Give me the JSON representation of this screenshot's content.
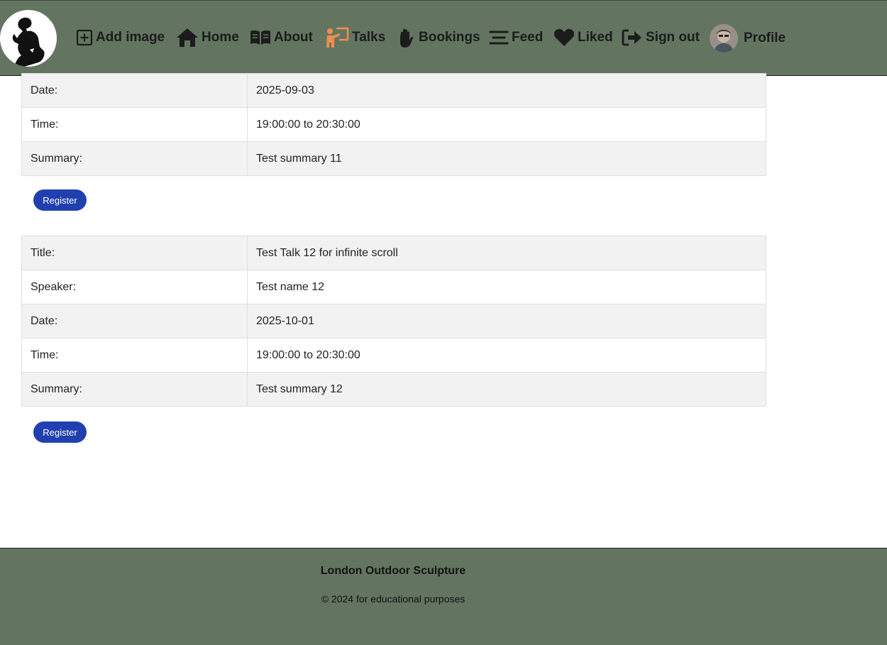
{
  "navbar": {
    "logo_icon": "thinker-silhouette-logo",
    "items": [
      {
        "label": "Add image",
        "icon": "plus-square-icon",
        "color": "#1c1c1c"
      },
      {
        "label": "Home",
        "icon": "home-icon",
        "color": "#1c1c1c"
      },
      {
        "label": "About",
        "icon": "book-open-icon",
        "color": "#1c1c1c"
      },
      {
        "label": "Talks",
        "icon": "lecturer-icon",
        "color": "#1c1c1c",
        "icon_color": "#f0904a"
      },
      {
        "label": "Bookings",
        "icon": "hand-icon",
        "color": "#1c1c1c"
      },
      {
        "label": "Feed",
        "icon": "stream-icon",
        "color": "#1c1c1c"
      },
      {
        "label": "Liked",
        "icon": "heart-icon",
        "color": "#1c1c1c"
      },
      {
        "label": "Sign out",
        "icon": "sign-out-icon",
        "color": "#1c1c1c"
      },
      {
        "label": "Profile",
        "icon": "avatar",
        "color": "#1c1c1c"
      }
    ]
  },
  "talks": [
    {
      "rows": [
        {
          "label": "Date:",
          "value": "2025-09-03"
        },
        {
          "label": "Time:",
          "value": "19:00:00 to 20:30:00"
        },
        {
          "label": "Summary:",
          "value": "Test summary 11"
        }
      ],
      "button": "Register"
    },
    {
      "rows": [
        {
          "label": "Title:",
          "value": "Test Talk 12 for infinite scroll"
        },
        {
          "label": "Speaker:",
          "value": "Test name 12"
        },
        {
          "label": "Date:",
          "value": "2025-10-01"
        },
        {
          "label": "Time:",
          "value": "19:00:00 to 20:30:00"
        },
        {
          "label": "Summary:",
          "value": "Test summary 12"
        }
      ],
      "button": "Register"
    }
  ],
  "footer": {
    "title": "London Outdoor Sculpture",
    "copyright": "© 2024 for educational purposes"
  },
  "colors": {
    "navbar_bg": "#637561",
    "button_bg": "#2140b0",
    "talks_icon_accent": "#f0904a"
  }
}
